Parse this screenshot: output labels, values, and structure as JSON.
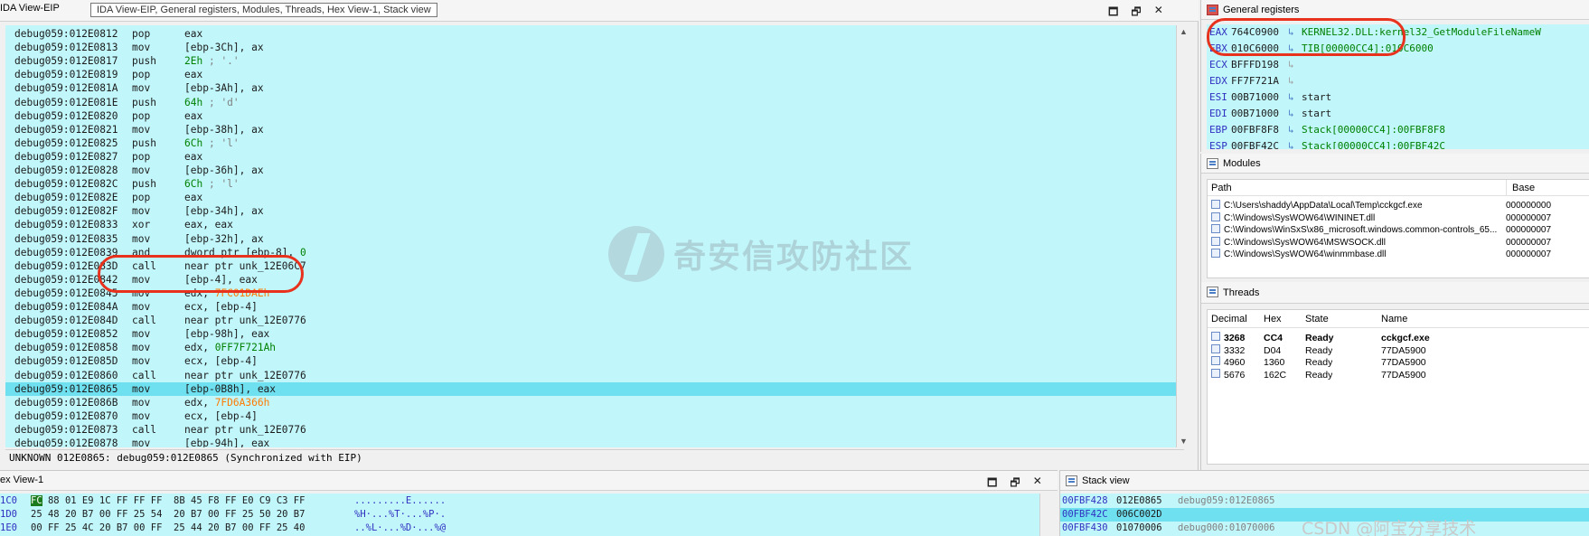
{
  "ida": {
    "tab_label": "IDA View-EIP",
    "tooltip": "IDA View-EIP, General registers, Modules, Threads, Hex View-1, Stack view",
    "status": "UNKNOWN 012E0865: debug059:012E0865 (Synchronized with EIP)",
    "lines": [
      {
        "addr": "debug059:012E0812",
        "mnem": "pop",
        "ops": "eax"
      },
      {
        "addr": "debug059:012E0813",
        "mnem": "mov",
        "ops": "[ebp-3Ch], ax"
      },
      {
        "addr": "debug059:012E0817",
        "mnem": "push",
        "ops": "2Eh ; '.'"
      },
      {
        "addr": "debug059:012E0819",
        "mnem": "pop",
        "ops": "eax"
      },
      {
        "addr": "debug059:012E081A",
        "mnem": "mov",
        "ops": "[ebp-3Ah], ax"
      },
      {
        "addr": "debug059:012E081E",
        "mnem": "push",
        "ops": "64h ; 'd'"
      },
      {
        "addr": "debug059:012E0820",
        "mnem": "pop",
        "ops": "eax"
      },
      {
        "addr": "debug059:012E0821",
        "mnem": "mov",
        "ops": "[ebp-38h], ax"
      },
      {
        "addr": "debug059:012E0825",
        "mnem": "push",
        "ops": "6Ch ; 'l'"
      },
      {
        "addr": "debug059:012E0827",
        "mnem": "pop",
        "ops": "eax"
      },
      {
        "addr": "debug059:012E0828",
        "mnem": "mov",
        "ops": "[ebp-36h], ax"
      },
      {
        "addr": "debug059:012E082C",
        "mnem": "push",
        "ops": "6Ch ; 'l'"
      },
      {
        "addr": "debug059:012E082E",
        "mnem": "pop",
        "ops": "eax"
      },
      {
        "addr": "debug059:012E082F",
        "mnem": "mov",
        "ops": "[ebp-34h], ax"
      },
      {
        "addr": "debug059:012E0833",
        "mnem": "xor",
        "ops": "eax, eax"
      },
      {
        "addr": "debug059:012E0835",
        "mnem": "mov",
        "ops": "[ebp-32h], ax"
      },
      {
        "addr": "debug059:012E0839",
        "mnem": "and",
        "ops": "dword ptr [ebp-8], 0"
      },
      {
        "addr": "debug059:012E083D",
        "mnem": "call",
        "ops": "near ptr unk_12E06C7"
      },
      {
        "addr": "debug059:012E0842",
        "mnem": "mov",
        "ops": "[ebp-4], eax"
      },
      {
        "addr": "debug059:012E0845",
        "mnem": "mov",
        "ops": "edx, 7FC01DAEh"
      },
      {
        "addr": "debug059:012E084A",
        "mnem": "mov",
        "ops": "ecx, [ebp-4]"
      },
      {
        "addr": "debug059:012E084D",
        "mnem": "call",
        "ops": "near ptr unk_12E0776"
      },
      {
        "addr": "debug059:012E0852",
        "mnem": "mov",
        "ops": "[ebp-98h], eax"
      },
      {
        "addr": "debug059:012E0858",
        "mnem": "mov",
        "ops": "edx, 0FF7F721Ah"
      },
      {
        "addr": "debug059:012E085D",
        "mnem": "mov",
        "ops": "ecx, [ebp-4]"
      },
      {
        "addr": "debug059:012E0860",
        "mnem": "call",
        "ops": "near ptr unk_12E0776"
      },
      {
        "addr": "debug059:012E0865",
        "mnem": "mov",
        "ops": "[ebp-0B8h], eax"
      },
      {
        "addr": "debug059:012E086B",
        "mnem": "mov",
        "ops": "edx, 7FD6A366h"
      },
      {
        "addr": "debug059:012E0870",
        "mnem": "mov",
        "ops": "ecx, [ebp-4]"
      },
      {
        "addr": "debug059:012E0873",
        "mnem": "call",
        "ops": "near ptr unk_12E0776"
      },
      {
        "addr": "debug059:012E0878",
        "mnem": "mov",
        "ops": "[ebp-94h], eax"
      }
    ]
  },
  "registers": {
    "title": "General registers",
    "rows": [
      {
        "name": "EAX",
        "value": "764C0900",
        "target": "KERNEL32.DLL:kernel32_GetModuleFileNameW"
      },
      {
        "name": "EBX",
        "value": "010C6000",
        "target": "TIB[00000CC4]:010C6000"
      },
      {
        "name": "ECX",
        "value": "BFFFD198",
        "target": ""
      },
      {
        "name": "EDX",
        "value": "FF7F721A",
        "target": ""
      },
      {
        "name": "ESI",
        "value": "00B71000",
        "target": "start"
      },
      {
        "name": "EDI",
        "value": "00B71000",
        "target": "start"
      },
      {
        "name": "EBP",
        "value": "00FBF8F8",
        "target": "Stack[00000CC4]:00FBF8F8"
      },
      {
        "name": "ESP",
        "value": "00FBF42C",
        "target": "Stack[00000CC4]:00FBF42C"
      }
    ]
  },
  "modules": {
    "title": "Modules",
    "col_path": "Path",
    "col_base": "Base",
    "rows": [
      {
        "path": "C:\\Users\\shaddy\\AppData\\Local\\Temp\\cckgcf.exe",
        "base": "000000000"
      },
      {
        "path": "C:\\Windows\\SysWOW64\\WININET.dll",
        "base": "000000007"
      },
      {
        "path": "C:\\Windows\\WinSxS\\x86_microsoft.windows.common-controls_65...",
        "base": "000000007"
      },
      {
        "path": "C:\\Windows\\SysWOW64\\MSWSOCK.dll",
        "base": "000000007"
      },
      {
        "path": "C:\\Windows\\SysWOW64\\winmmbase.dll",
        "base": "000000007"
      }
    ]
  },
  "threads": {
    "title": "Threads",
    "col_decimal": "Decimal",
    "col_hex": "Hex",
    "col_state": "State",
    "col_name": "Name",
    "rows": [
      {
        "decimal": "3268",
        "hex": "CC4",
        "state": "Ready",
        "name": "cckgcf.exe"
      },
      {
        "decimal": "3332",
        "hex": "D04",
        "state": "Ready",
        "name": "77DA5900"
      },
      {
        "decimal": "4960",
        "hex": "1360",
        "state": "Ready",
        "name": "77DA5900"
      },
      {
        "decimal": "5676",
        "hex": "162C",
        "state": "Ready",
        "name": "77DA5900"
      }
    ]
  },
  "hex": {
    "tab_label": "ex View-1",
    "lines": [
      {
        "addr": "1C0",
        "first": "FC",
        "bytes": "88 01 E9 1C FF FF FF  8B 45 F8 FF E0 C9 C3 FF",
        "ascii": ".........E......"
      },
      {
        "addr": "1D0",
        "first": "25",
        "bytes": "48 20 B7 00 FF 25 54  20 B7 00 FF 25 50 20 B7",
        "ascii": "%H·...%T·...%P·."
      },
      {
        "addr": "1E0",
        "first": "00",
        "bytes": "FF 25 4C 20 B7 00 FF  25 44 20 B7 00 FF 25 40",
        "ascii": "..%L·...%D·...%@"
      }
    ]
  },
  "stack": {
    "title": "Stack view",
    "lines": [
      {
        "addr": "00FBF428",
        "value": "012E0865",
        "comment": "debug059:012E0865"
      },
      {
        "addr": "00FBF42C",
        "value": "006C002D",
        "comment": ""
      },
      {
        "addr": "00FBF430",
        "value": "01070006",
        "comment": "debug000:01070006"
      }
    ]
  },
  "watermark": {
    "text": "奇安信攻防社区",
    "csdn": "CSDN @阿宝分享技术"
  },
  "colors": {
    "code_bg": "#c1f7fb",
    "highlight_bg": "#6fe0f0",
    "annotation": "#e8321e"
  }
}
